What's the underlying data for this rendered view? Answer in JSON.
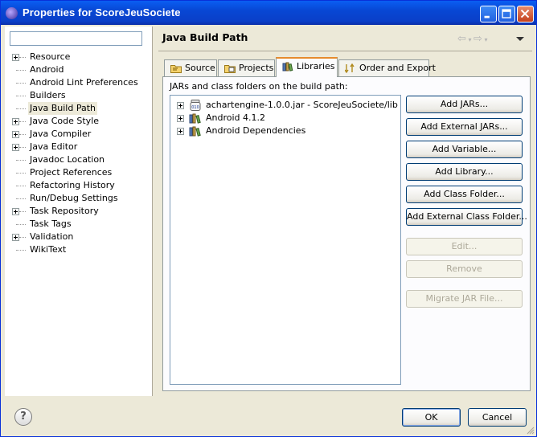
{
  "window": {
    "title": "Properties for ScoreJeuSociete",
    "colors": {
      "titlebar": "#0a5ef2",
      "face": "#ece9d8",
      "active_tab_accent": "#e68b2c"
    }
  },
  "filter": {
    "value": "",
    "placeholder": ""
  },
  "tree": [
    {
      "label": "Resource",
      "expandable": true
    },
    {
      "label": "Android",
      "expandable": false
    },
    {
      "label": "Android Lint Preferences",
      "expandable": false
    },
    {
      "label": "Builders",
      "expandable": false
    },
    {
      "label": "Java Build Path",
      "expandable": false,
      "selected": true
    },
    {
      "label": "Java Code Style",
      "expandable": true
    },
    {
      "label": "Java Compiler",
      "expandable": true
    },
    {
      "label": "Java Editor",
      "expandable": true
    },
    {
      "label": "Javadoc Location",
      "expandable": false
    },
    {
      "label": "Project References",
      "expandable": false
    },
    {
      "label": "Refactoring History",
      "expandable": false
    },
    {
      "label": "Run/Debug Settings",
      "expandable": false
    },
    {
      "label": "Task Repository",
      "expandable": true
    },
    {
      "label": "Task Tags",
      "expandable": false
    },
    {
      "label": "Validation",
      "expandable": true
    },
    {
      "label": "WikiText",
      "expandable": false
    }
  ],
  "page": {
    "title": "Java Build Path"
  },
  "tabs": [
    {
      "label": "Source",
      "icon": "source-folder-icon"
    },
    {
      "label": "Projects",
      "icon": "projects-folder-icon"
    },
    {
      "label": "Libraries",
      "icon": "libraries-icon",
      "active": true
    },
    {
      "label": "Order and Export",
      "icon": "order-export-icon"
    }
  ],
  "libraries": {
    "list_label": "JARs and class folders on the build path:",
    "items": [
      {
        "text": "achartengine-1.0.0.jar - ScoreJeuSociete/lib",
        "icon": "jar-icon"
      },
      {
        "text": "Android 4.1.2",
        "icon": "library-icon"
      },
      {
        "text": "Android Dependencies",
        "icon": "library-icon"
      }
    ]
  },
  "buttons": {
    "add_jars": "Add JARs...",
    "add_external_jars": "Add External JARs...",
    "add_variable": "Add Variable...",
    "add_library": "Add Library...",
    "add_class_folder": "Add Class Folder...",
    "add_external_class_folder": "Add External Class Folder...",
    "edit": "Edit...",
    "remove": "Remove",
    "migrate_jar": "Migrate JAR File..."
  },
  "footer": {
    "help": "?",
    "ok": "OK",
    "cancel": "Cancel"
  }
}
